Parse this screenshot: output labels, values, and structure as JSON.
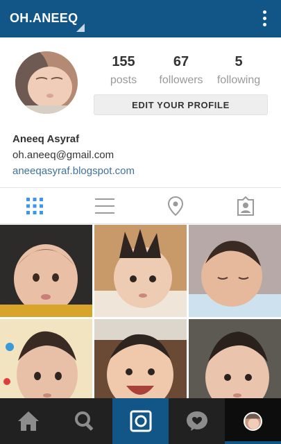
{
  "header": {
    "username": "OH.ANEEQ",
    "menu_icon": "more-vertical-icon"
  },
  "profile": {
    "stats": [
      {
        "value": "155",
        "label": "posts"
      },
      {
        "value": "67",
        "label": "followers"
      },
      {
        "value": "5",
        "label": "following"
      }
    ],
    "edit_button": "EDIT YOUR PROFILE",
    "name": "Aneeq Asyraf",
    "email": "oh.aneeq@gmail.com",
    "website": "aneeqasyraf.blogspot.com"
  },
  "view_tabs": [
    {
      "icon": "grid-icon",
      "active": true
    },
    {
      "icon": "list-icon",
      "active": false
    },
    {
      "icon": "location-pin-icon",
      "active": false
    },
    {
      "icon": "tagged-photos-icon",
      "active": false
    }
  ],
  "bottom_nav": [
    {
      "icon": "home-icon"
    },
    {
      "icon": "search-icon"
    },
    {
      "icon": "camera-icon"
    },
    {
      "icon": "activity-heart-icon"
    },
    {
      "icon": "profile-avatar-icon"
    }
  ],
  "colors": {
    "brand": "#125688",
    "link": "#3f729b",
    "nav_background": "#212121",
    "active_tab": "#3897f0"
  }
}
